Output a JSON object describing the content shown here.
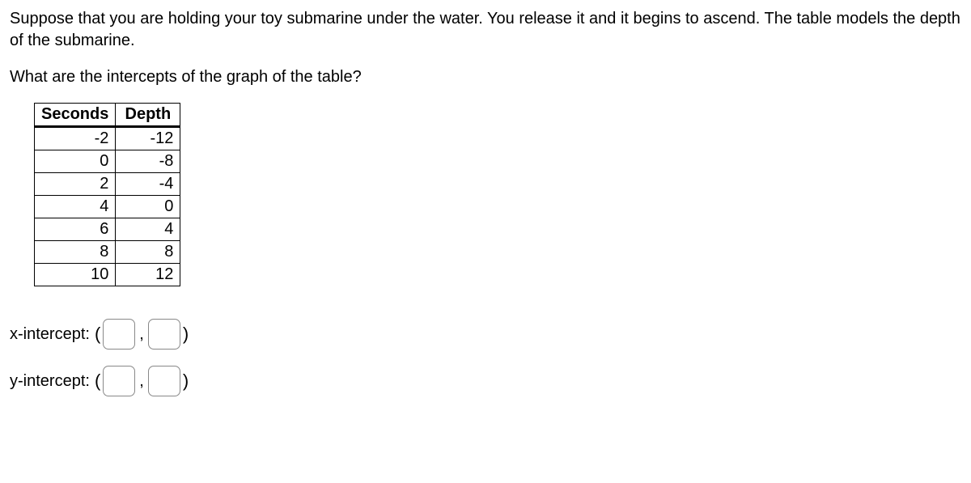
{
  "prompt": "Suppose that you are holding your toy submarine under the water. You release it and it begins to ascend. The table models the depth of the submarine.",
  "question": "What are the intercepts of the graph of the table?",
  "table": {
    "headers": {
      "col1": "Seconds",
      "col2": "Depth"
    },
    "rows": [
      {
        "seconds": "-2",
        "depth": "-12"
      },
      {
        "seconds": "0",
        "depth": "-8"
      },
      {
        "seconds": "2",
        "depth": "-4"
      },
      {
        "seconds": "4",
        "depth": "0"
      },
      {
        "seconds": "6",
        "depth": "4"
      },
      {
        "seconds": "8",
        "depth": "8"
      },
      {
        "seconds": "10",
        "depth": "12"
      }
    ]
  },
  "answers": {
    "x_label": "x-intercept:",
    "y_label": "y-intercept:",
    "open_paren": "(",
    "close_paren": ")",
    "comma": ",",
    "x1": "",
    "x2": "",
    "y1": "",
    "y2": ""
  }
}
